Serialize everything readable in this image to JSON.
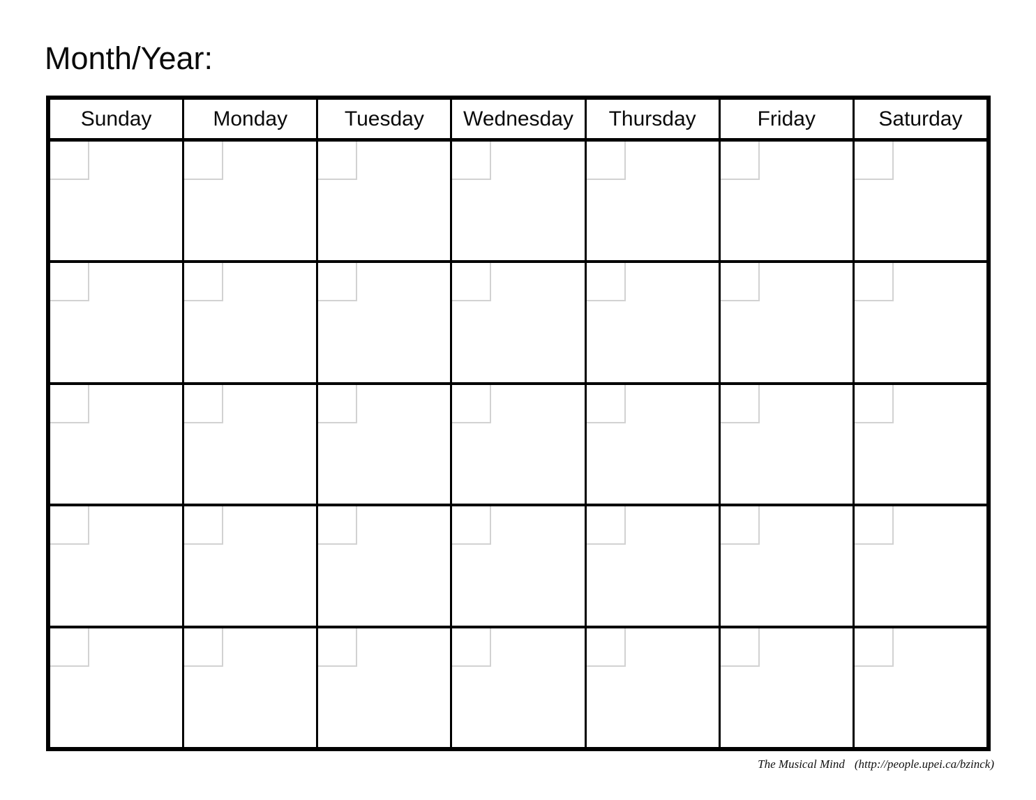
{
  "page": {
    "title_label": "Month/Year:",
    "background_color": "#ffffff",
    "ink_color": "#000000",
    "date_box_border_color": "#d2d2d2"
  },
  "calendar": {
    "weekday_headers": [
      "Sunday",
      "Monday",
      "Tuesday",
      "Wednesday",
      "Thursday",
      "Friday",
      "Saturday"
    ],
    "week_count": 5,
    "days_per_week": 7,
    "cells": [
      [
        "",
        "",
        "",
        "",
        "",
        "",
        ""
      ],
      [
        "",
        "",
        "",
        "",
        "",
        "",
        ""
      ],
      [
        "",
        "",
        "",
        "",
        "",
        "",
        ""
      ],
      [
        "",
        "",
        "",
        "",
        "",
        "",
        ""
      ],
      [
        "",
        "",
        "",
        "",
        "",
        "",
        ""
      ]
    ]
  },
  "footer": {
    "credit_name": "The Musical Mind",
    "credit_url": "(http://people.upei.ca/bzinck)"
  }
}
